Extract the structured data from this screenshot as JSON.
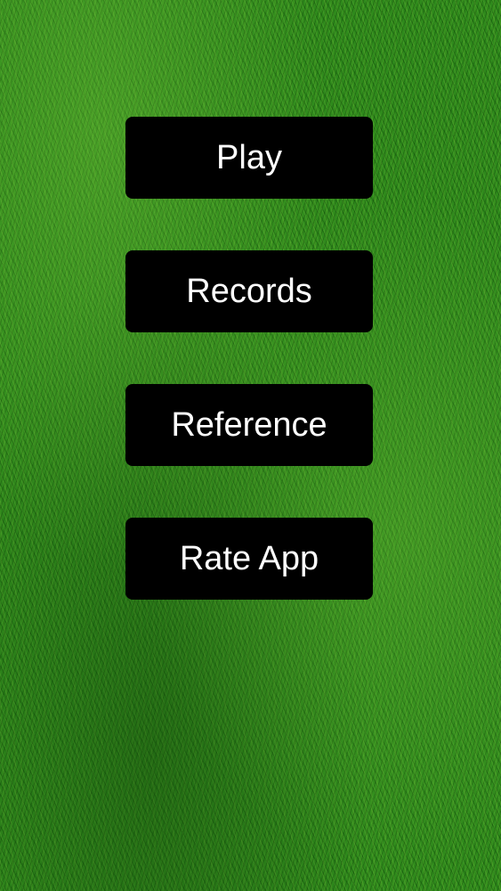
{
  "background": {
    "texture": "grass",
    "base_color": "#2f8a1c"
  },
  "menu": {
    "button_color": "#000000",
    "text_color": "#ffffff",
    "items": [
      {
        "label": "Play"
      },
      {
        "label": "Records"
      },
      {
        "label": "Reference"
      },
      {
        "label": "Rate App"
      }
    ]
  }
}
